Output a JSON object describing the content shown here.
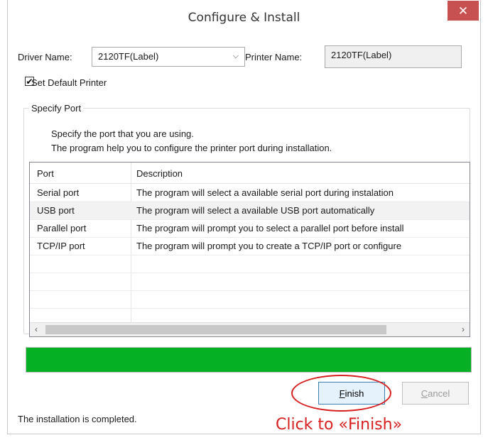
{
  "window": {
    "title": "Configure & Install",
    "close_symbol": "✕"
  },
  "driver": {
    "label": "Driver Name:",
    "value": "2120TF(Label)"
  },
  "printer": {
    "label": "Printer Name:",
    "value": "2120TF(Label)"
  },
  "default_printer": {
    "label": "Set Default Printer",
    "checked": true
  },
  "port_group": {
    "legend": "Specify Port",
    "help_line1": "Specify the port that you are using.",
    "help_line2": "The program help you to configure the printer port during installation."
  },
  "ports_table": {
    "columns": [
      "Port",
      "Description"
    ],
    "rows": [
      {
        "port": "Serial port",
        "description": "The program will select a available serial port during instalation"
      },
      {
        "port": "USB port",
        "description": "The program will select a available USB port automatically"
      },
      {
        "port": "Parallel port",
        "description": "The program will prompt you to select a parallel port before install"
      },
      {
        "port": "TCP/IP port",
        "description": "The program will prompt you to create a TCP/IP port or configure"
      }
    ],
    "highlighted_row": 1
  },
  "progress": {
    "percent": 100,
    "color": "#06b025"
  },
  "buttons": {
    "finish": {
      "accel": "F",
      "rest": "inish"
    },
    "cancel": {
      "accel": "C",
      "rest": "ancel"
    }
  },
  "status_text": "The installation is completed.",
  "annotation": {
    "text": "Click to «Finish»",
    "color": "#d82020"
  },
  "icons": {
    "dropdown": "chevron-down-icon",
    "check": "checkmark-icon",
    "scroll_left": "chevron-left-icon",
    "scroll_right": "chevron-right-icon"
  }
}
